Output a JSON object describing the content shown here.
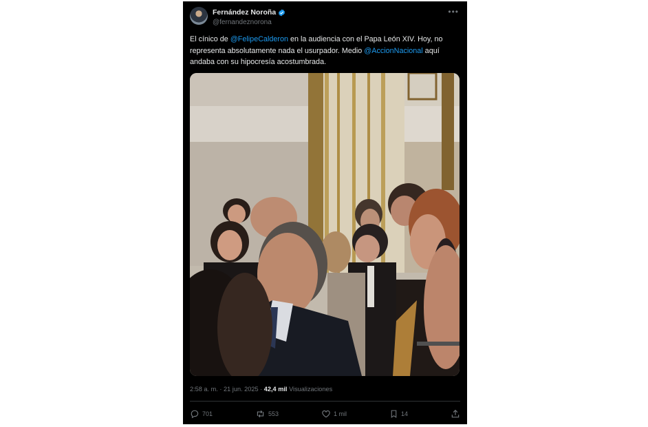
{
  "author": {
    "name": "Fernández Noroña",
    "handle": "@fernandeznorona"
  },
  "tweet": {
    "text_1": "El cínico de ",
    "mention_1": "@FelipeCalderon",
    "text_2": " en la audiencia con el Papa León XIV. Hoy, no representa absolutamente nada el usurpador. Medio ",
    "mention_2": "@AccionNacional",
    "text_3": " aquí andaba con su hipocresía acostumbrada."
  },
  "meta": {
    "time": "2:58 a. m.",
    "separator": " · ",
    "date": "21 jun. 2025",
    "views_count": "42,4 mil",
    "views_label": "Visualizaciones"
  },
  "actions": {
    "replies": "701",
    "reposts": "553",
    "likes": "1 mil",
    "bookmarks": "14"
  },
  "colors": {
    "background": "#000000",
    "text": "#e7e9ea",
    "secondary": "#71767b",
    "link": "#1d9bf0",
    "verified": "#1d9bf0"
  },
  "icons": [
    "verified-badge-icon",
    "more-options-icon",
    "reply-icon",
    "repost-icon",
    "like-icon",
    "bookmark-icon",
    "share-icon"
  ]
}
